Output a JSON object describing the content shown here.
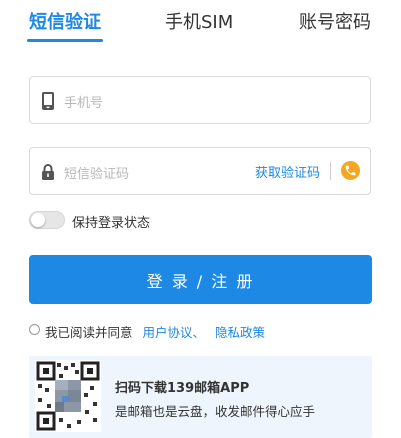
{
  "tabs": [
    {
      "label": "短信验证",
      "active": true
    },
    {
      "label": "手机SIM",
      "active": false
    },
    {
      "label": "账号密码",
      "active": false
    }
  ],
  "phone_field": {
    "placeholder": "手机号",
    "icon": "phone-icon"
  },
  "sms_field": {
    "placeholder": "短信验证码",
    "icon": "lock-icon",
    "get_code_label": "获取验证码",
    "voice_icon": "phone-call-icon"
  },
  "keep_login": {
    "label": "保持登录状态",
    "enabled": false
  },
  "login_button": {
    "label": "登 录 / 注 册"
  },
  "agreement": {
    "prefix": "我已阅读并同意",
    "user_agreement": "用户协议、",
    "privacy_policy": "隐私政策",
    "checked": false
  },
  "promo": {
    "title": "扫码下载139邮箱APP",
    "subtitle": "是邮箱也是云盘，收发邮件得心应手",
    "icon": "qr-code-icon"
  },
  "colors": {
    "accent": "#1e88e5",
    "voice": "#f5a623",
    "promo_bg": "#eef5fd"
  }
}
